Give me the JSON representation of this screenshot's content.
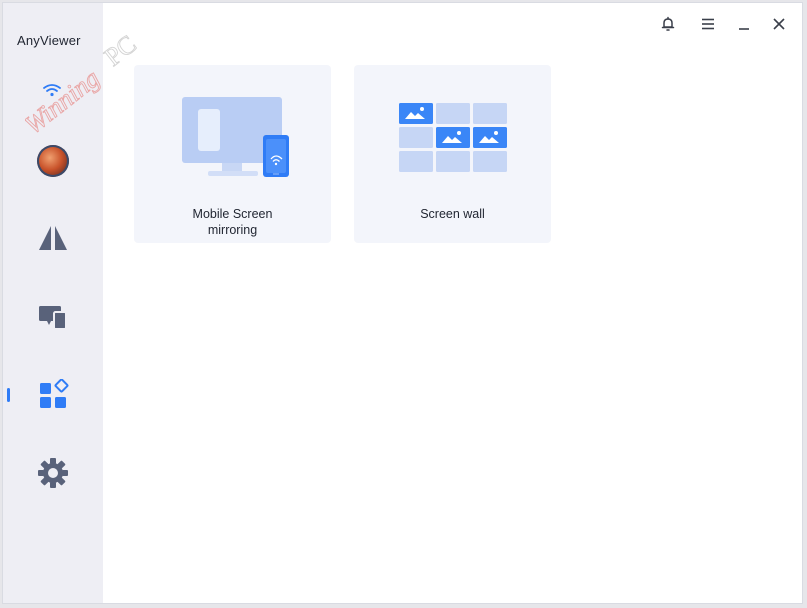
{
  "app": {
    "title": "AnyViewer"
  },
  "watermark": {
    "text1": "Winning",
    "text2": "PC"
  },
  "sidebar": {
    "items": [
      {
        "id": "connection-status",
        "icon": "wifi-icon"
      },
      {
        "id": "account",
        "icon": "avatar"
      },
      {
        "id": "remote-control",
        "icon": "remote-control-icon"
      },
      {
        "id": "devices",
        "icon": "devices-icon"
      },
      {
        "id": "tools",
        "icon": "tools-icon",
        "active": true
      },
      {
        "id": "settings",
        "icon": "gear-icon"
      }
    ]
  },
  "titlebar": {
    "controls": [
      "bell-icon",
      "menu-icon",
      "minimize-icon",
      "close-icon"
    ]
  },
  "cards": [
    {
      "id": "mobile-screen-mirroring",
      "label_line1": "Mobile Screen",
      "label_line2": "mirroring",
      "icon": "monitor-phone-illustration"
    },
    {
      "id": "screen-wall",
      "label": "Screen wall",
      "icon": "screen-wall-illustration"
    }
  ],
  "colors": {
    "accent": "#2f7cf6",
    "sidebar_bg": "#eeeef4",
    "card_bg": "#f3f5fb",
    "icon_gray": "#59627a"
  }
}
